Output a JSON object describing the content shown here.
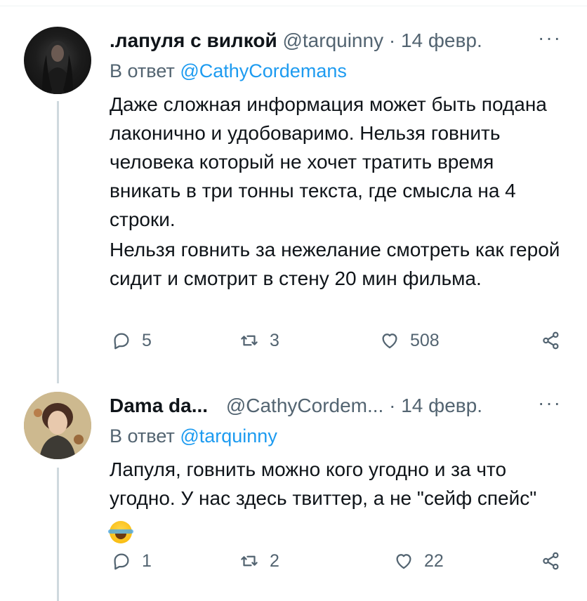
{
  "tweets": [
    {
      "author_name": ".лапуля с вилкой",
      "handle": "@tarquinny",
      "separator": "·",
      "date": "14 февр.",
      "more_label": "···",
      "reply_prefix": "В ответ",
      "reply_to": "@CathyCordemans",
      "text_paragraphs": [
        "Даже сложная информация может быть подана лаконично и удобоваримо. Нельзя говнить человека который не хочет тратить время вникать в три тонны текста, где смысла на 4 строки.",
        "Нельзя говнить за нежелание смотреть как герой сидит и смотрит в стену 20 мин фильма."
      ],
      "replies": "5",
      "retweets": "3",
      "likes": "508"
    },
    {
      "author_name": "Dama da...",
      "handle": "@CathyCordem...",
      "separator": "·",
      "date": "14 февр.",
      "more_label": "···",
      "reply_prefix": "В ответ",
      "reply_to": "@tarquinny",
      "text_paragraphs": [
        "Лапуля, говнить можно кого угодно и за что угодно. У нас здесь твиттер, а не \"сейф спейс\""
      ],
      "emoji": "face-with-tears-of-joy",
      "replies": "1",
      "retweets": "2",
      "likes": "22"
    }
  ],
  "icons": {
    "reply": "reply-icon",
    "retweet": "retweet-icon",
    "like": "heart-icon",
    "share": "share-icon"
  },
  "colors": {
    "text": "#0f1419",
    "muted": "#536471",
    "link": "#1d9bf0",
    "thread_line": "#cfd9de"
  }
}
